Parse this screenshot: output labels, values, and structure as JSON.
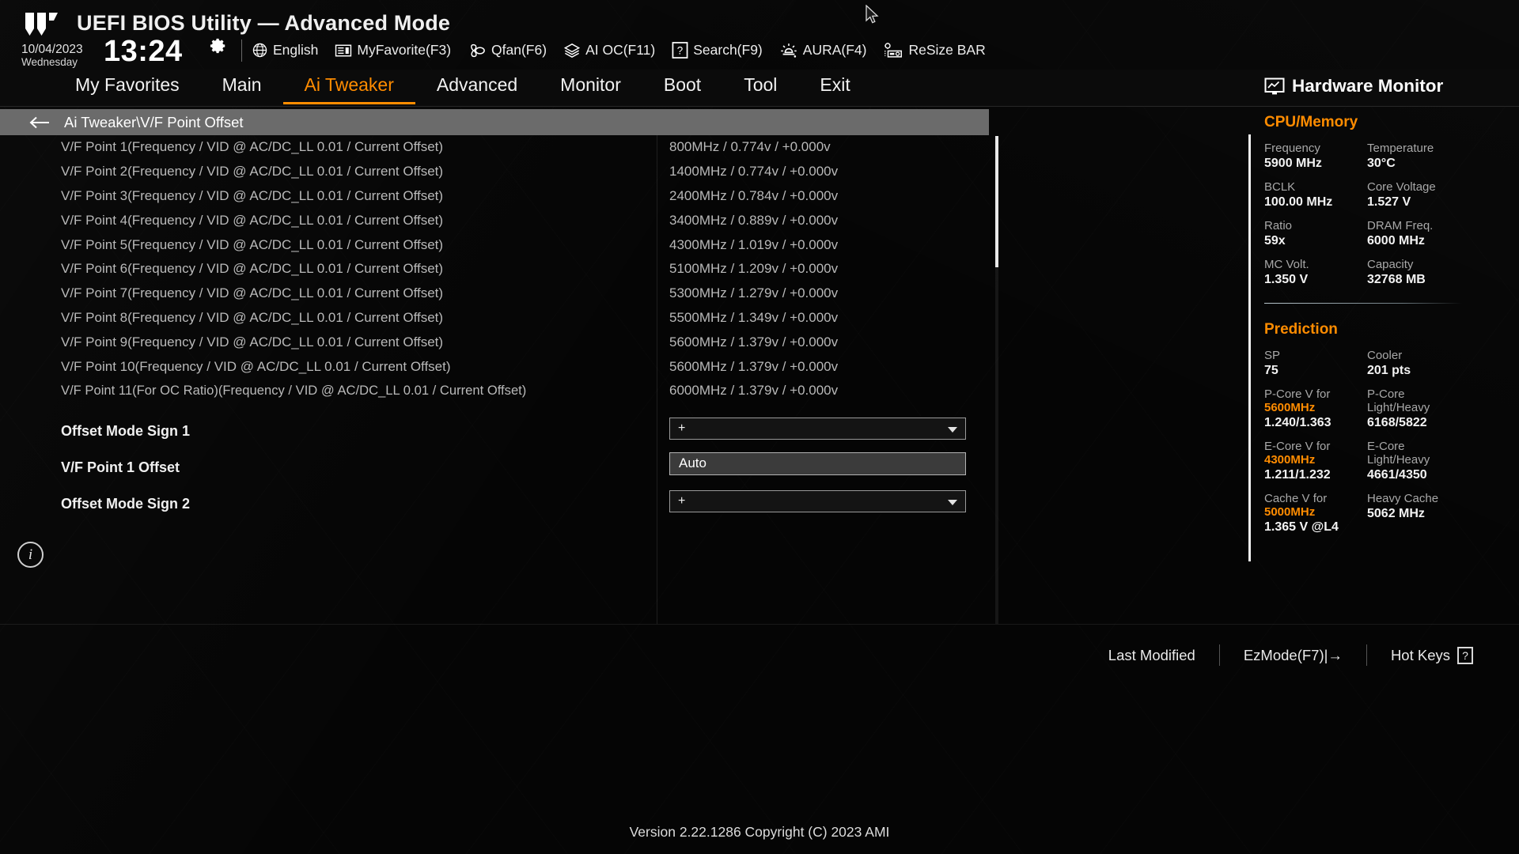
{
  "header": {
    "logo_icon": "tuf-gaming-logo",
    "title": "UEFI BIOS Utility — Advanced Mode",
    "date": "10/04/2023",
    "weekday": "Wednesday",
    "time": "13:24",
    "gear_icon": "gear-icon",
    "tools": [
      {
        "icon": "globe-icon",
        "label": "English"
      },
      {
        "icon": "favorites-icon",
        "label": "MyFavorite(F3)"
      },
      {
        "icon": "qfan-icon",
        "label": "Qfan(F6)"
      },
      {
        "icon": "ai-oc-icon",
        "label": "AI OC(F11)"
      },
      {
        "icon": "question-box-icon",
        "label": "Search(F9)"
      },
      {
        "icon": "aura-icon",
        "label": "AURA(F4)"
      },
      {
        "icon": "resize-bar-icon",
        "label": "ReSize BAR"
      }
    ]
  },
  "nav": {
    "active": "Ai Tweaker",
    "tabs": [
      {
        "label": "My Favorites"
      },
      {
        "label": "Main"
      },
      {
        "label": "Ai Tweaker"
      },
      {
        "label": "Advanced"
      },
      {
        "label": "Monitor"
      },
      {
        "label": "Boot"
      },
      {
        "label": "Tool"
      },
      {
        "label": "Exit"
      }
    ]
  },
  "breadcrumb": {
    "back_icon": "back-arrow-icon",
    "path": "Ai Tweaker\\V/F Point Offset"
  },
  "main": {
    "vf_points": [
      {
        "name": "V/F Point 1(Frequency / VID @ AC/DC_LL 0.01 / Current Offset)",
        "value": "800MHz / 0.774v / +0.000v"
      },
      {
        "name": "V/F Point 2(Frequency / VID @ AC/DC_LL 0.01 / Current Offset)",
        "value": "1400MHz / 0.774v / +0.000v"
      },
      {
        "name": "V/F Point 3(Frequency / VID @ AC/DC_LL 0.01 / Current Offset)",
        "value": "2400MHz / 0.784v / +0.000v"
      },
      {
        "name": "V/F Point 4(Frequency / VID @ AC/DC_LL 0.01 / Current Offset)",
        "value": "3400MHz / 0.889v / +0.000v"
      },
      {
        "name": "V/F Point 5(Frequency / VID @ AC/DC_LL 0.01 / Current Offset)",
        "value": "4300MHz / 1.019v / +0.000v"
      },
      {
        "name": "V/F Point 6(Frequency / VID @ AC/DC_LL 0.01 / Current Offset)",
        "value": "5100MHz / 1.209v / +0.000v"
      },
      {
        "name": "V/F Point 7(Frequency / VID @ AC/DC_LL 0.01 / Current Offset)",
        "value": "5300MHz / 1.279v / +0.000v"
      },
      {
        "name": "V/F Point 8(Frequency / VID @ AC/DC_LL 0.01 / Current Offset)",
        "value": "5500MHz / 1.349v / +0.000v"
      },
      {
        "name": "V/F Point 9(Frequency / VID @ AC/DC_LL 0.01 / Current Offset)",
        "value": "5600MHz / 1.379v / +0.000v"
      },
      {
        "name": "V/F Point 10(Frequency / VID @ AC/DC_LL 0.01 / Current Offset)",
        "value": "5600MHz / 1.379v / +0.000v"
      },
      {
        "name": "V/F Point 11(For OC Ratio)(Frequency / VID @ AC/DC_LL 0.01 / Current Offset)",
        "value": "6000MHz / 1.379v / +0.000v"
      }
    ],
    "controls": [
      {
        "type": "select",
        "name": "Offset Mode Sign 1",
        "value": "+"
      },
      {
        "type": "textfield",
        "name": "V/F Point 1 Offset",
        "value": "Auto"
      },
      {
        "type": "select",
        "name": "Offset Mode Sign 2",
        "value": "+"
      }
    ],
    "info_icon": "info-icon"
  },
  "hardware_monitor": {
    "monitor_icon": "monitor-graph-icon",
    "title": "Hardware Monitor",
    "cpu_memory": {
      "section": "CPU/Memory",
      "pairs": [
        {
          "k1": "Frequency",
          "v1": "5900 MHz",
          "k2": "Temperature",
          "v2": "30°C"
        },
        {
          "k1": "BCLK",
          "v1": "100.00 MHz",
          "k2": "Core Voltage",
          "v2": "1.527 V"
        },
        {
          "k1": "Ratio",
          "v1": "59x",
          "k2": "DRAM Freq.",
          "v2": "6000 MHz"
        },
        {
          "k1": "MC Volt.",
          "v1": "1.350 V",
          "k2": "Capacity",
          "v2": "32768 MB"
        }
      ]
    },
    "prediction": {
      "section": "Prediction",
      "sp_label": "SP",
      "sp_value": "75",
      "cooler_label": "Cooler",
      "cooler_value": "201 pts",
      "pcore_label_a": "P-Core V for",
      "pcore_label_b": "5600MHz",
      "pcore_right_a": "P-Core",
      "pcore_right_b": "Light/Heavy",
      "pcore_v": "1.240/1.363",
      "pcore_pts": "6168/5822",
      "ecore_label_a": "E-Core V for",
      "ecore_label_b": "4300MHz",
      "ecore_right_a": "E-Core",
      "ecore_right_b": "Light/Heavy",
      "ecore_v": "1.211/1.232",
      "ecore_pts": "4661/4350",
      "cache_label_a": "Cache V for",
      "cache_label_b": "5000MHz",
      "cache_right_a": "Heavy Cache",
      "cache_right_b": "",
      "cache_v": "1.365 V @L4",
      "cache_pts": "5062 MHz"
    }
  },
  "footer": {
    "last_modified": "Last Modified",
    "ezmode": "EzMode(F7)|→",
    "hotkeys": "Hot Keys",
    "hotkeys_icon": "question-box-icon",
    "version": "Version 2.22.1286 Copyright (C) 2023 AMI"
  },
  "colors": {
    "accent": "#ff8c00",
    "bg": "#050505",
    "crumb": "#6b6b6b"
  }
}
